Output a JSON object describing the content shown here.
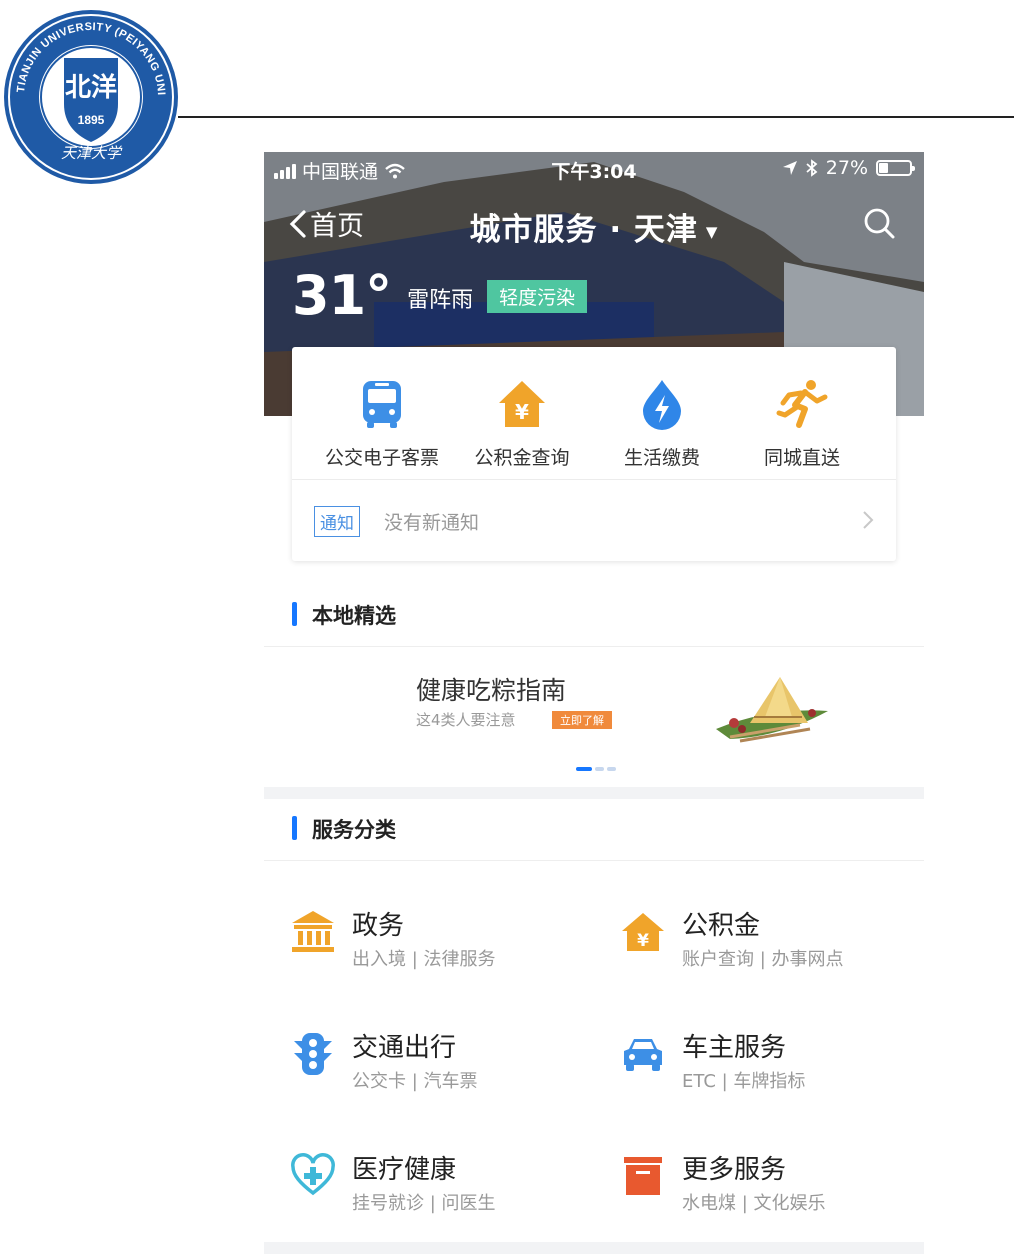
{
  "document": {
    "seal": {
      "university_en": "TIANJIN UNIVERSITY (PEIYANG UNIVERSITY)",
      "year": "1895",
      "name_cn": "天津大学",
      "emblem_text": "北洋"
    }
  },
  "status_bar": {
    "carrier": "中国联通",
    "time": "下午3:04",
    "battery": "27%"
  },
  "nav": {
    "back_label": "首页",
    "title": "城市服务 · 天津"
  },
  "weather": {
    "temperature": "31°",
    "condition": "雷阵雨",
    "air_quality": "轻度污染"
  },
  "quick_services": [
    {
      "label": "公交电子客票",
      "icon": "bus-icon",
      "color": "#3d8fe6"
    },
    {
      "label": "公积金查询",
      "icon": "fund-house-icon",
      "color": "#f0a42a"
    },
    {
      "label": "生活缴费",
      "icon": "bolt-drop-icon",
      "color": "#2f86e8"
    },
    {
      "label": "同城直送",
      "icon": "runner-icon",
      "color": "#f0a42a"
    }
  ],
  "notice": {
    "tag": "通知",
    "text": "没有新通知"
  },
  "local_section": {
    "title": "本地精选"
  },
  "banner": {
    "title": "健康吃粽指南",
    "subtitle": "这4类人要注意",
    "cta": "立即了解"
  },
  "category_section": {
    "title": "服务分类"
  },
  "categories": [
    {
      "name": "政务",
      "sub": "出入境 | 法律服务",
      "icon": "government-building-icon",
      "color": "#f0a42a"
    },
    {
      "name": "公积金",
      "sub": "账户查询 | 办事网点",
      "icon": "fund-house-icon",
      "color": "#f0a42a"
    },
    {
      "name": "交通出行",
      "sub": "公交卡 | 汽车票",
      "icon": "traffic-light-icon",
      "color": "#3d8fe6"
    },
    {
      "name": "车主服务",
      "sub": "ETC | 车牌指标",
      "icon": "car-icon",
      "color": "#3d8fe6"
    },
    {
      "name": "医疗健康",
      "sub": "挂号就诊 | 问医生",
      "icon": "health-heart-icon",
      "color": "#3fb8d8"
    },
    {
      "name": "更多服务",
      "sub": "水电煤 | 文化娱乐",
      "icon": "box-icon",
      "color": "#e8592f"
    }
  ]
}
